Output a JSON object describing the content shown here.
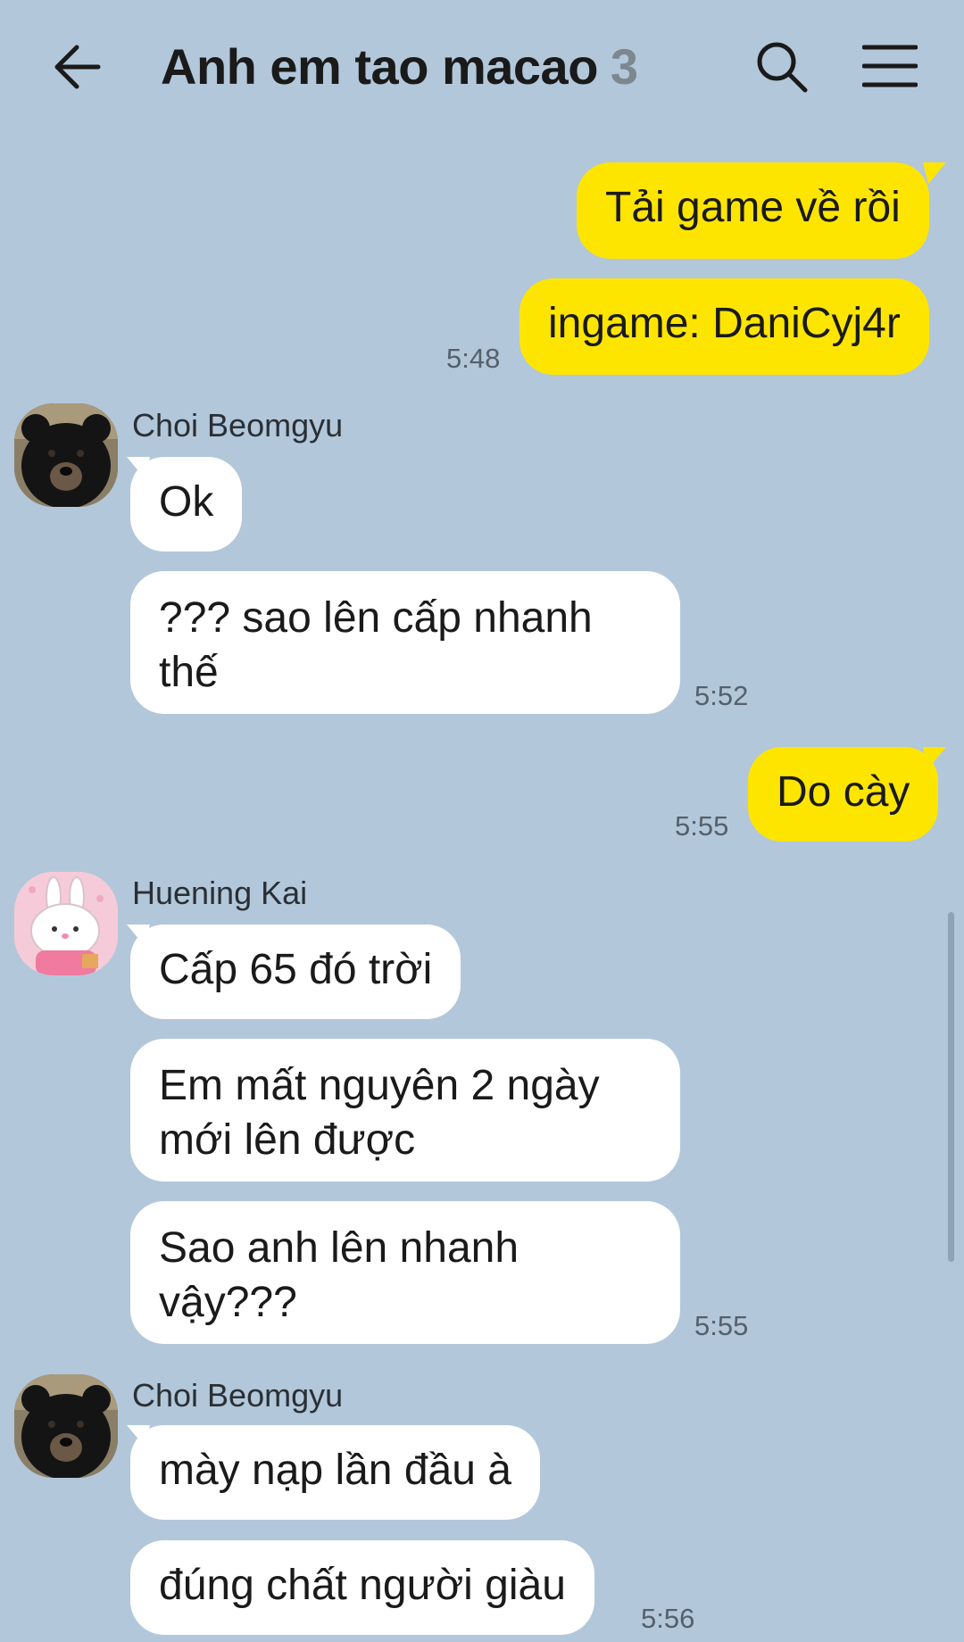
{
  "header": {
    "title": "Anh em tao macao",
    "member_count": "3",
    "icons": {
      "back": "back-arrow-icon",
      "search": "search-icon",
      "menu": "hamburger-menu-icon"
    }
  },
  "colors": {
    "background": "#b2c7da",
    "outgoing_bubble": "#fee500",
    "incoming_bubble": "#ffffff"
  },
  "messages": [
    {
      "type": "out",
      "text": "Tải game về rồi",
      "time": ""
    },
    {
      "type": "out",
      "text": "ingame: DaniCyj4r",
      "time": "5:48"
    },
    {
      "type": "in",
      "sender": "Choi Beomgyu",
      "text": "Ok",
      "time": ""
    },
    {
      "type": "in",
      "sender": "Choi Beomgyu",
      "text": "??? sao lên cấp nhanh thế",
      "time": "5:52"
    },
    {
      "type": "out",
      "text": "Do cày",
      "time": "5:55"
    },
    {
      "type": "in",
      "sender": "Huening Kai",
      "text": "Cấp 65 đó trời",
      "time": ""
    },
    {
      "type": "in",
      "sender": "Huening Kai",
      "text": "Em mất nguyên 2 ngày mới lên được",
      "time": ""
    },
    {
      "type": "in",
      "sender": "Huening Kai",
      "text": "Sao anh lên nhanh vậy???",
      "time": "5:55"
    },
    {
      "type": "in",
      "sender": "Choi Beomgyu",
      "text": "mày nạp lần đầu à",
      "time": ""
    },
    {
      "type": "in",
      "sender": "Choi Beomgyu",
      "text": "đúng chất người giàu",
      "time": "5:56"
    }
  ]
}
